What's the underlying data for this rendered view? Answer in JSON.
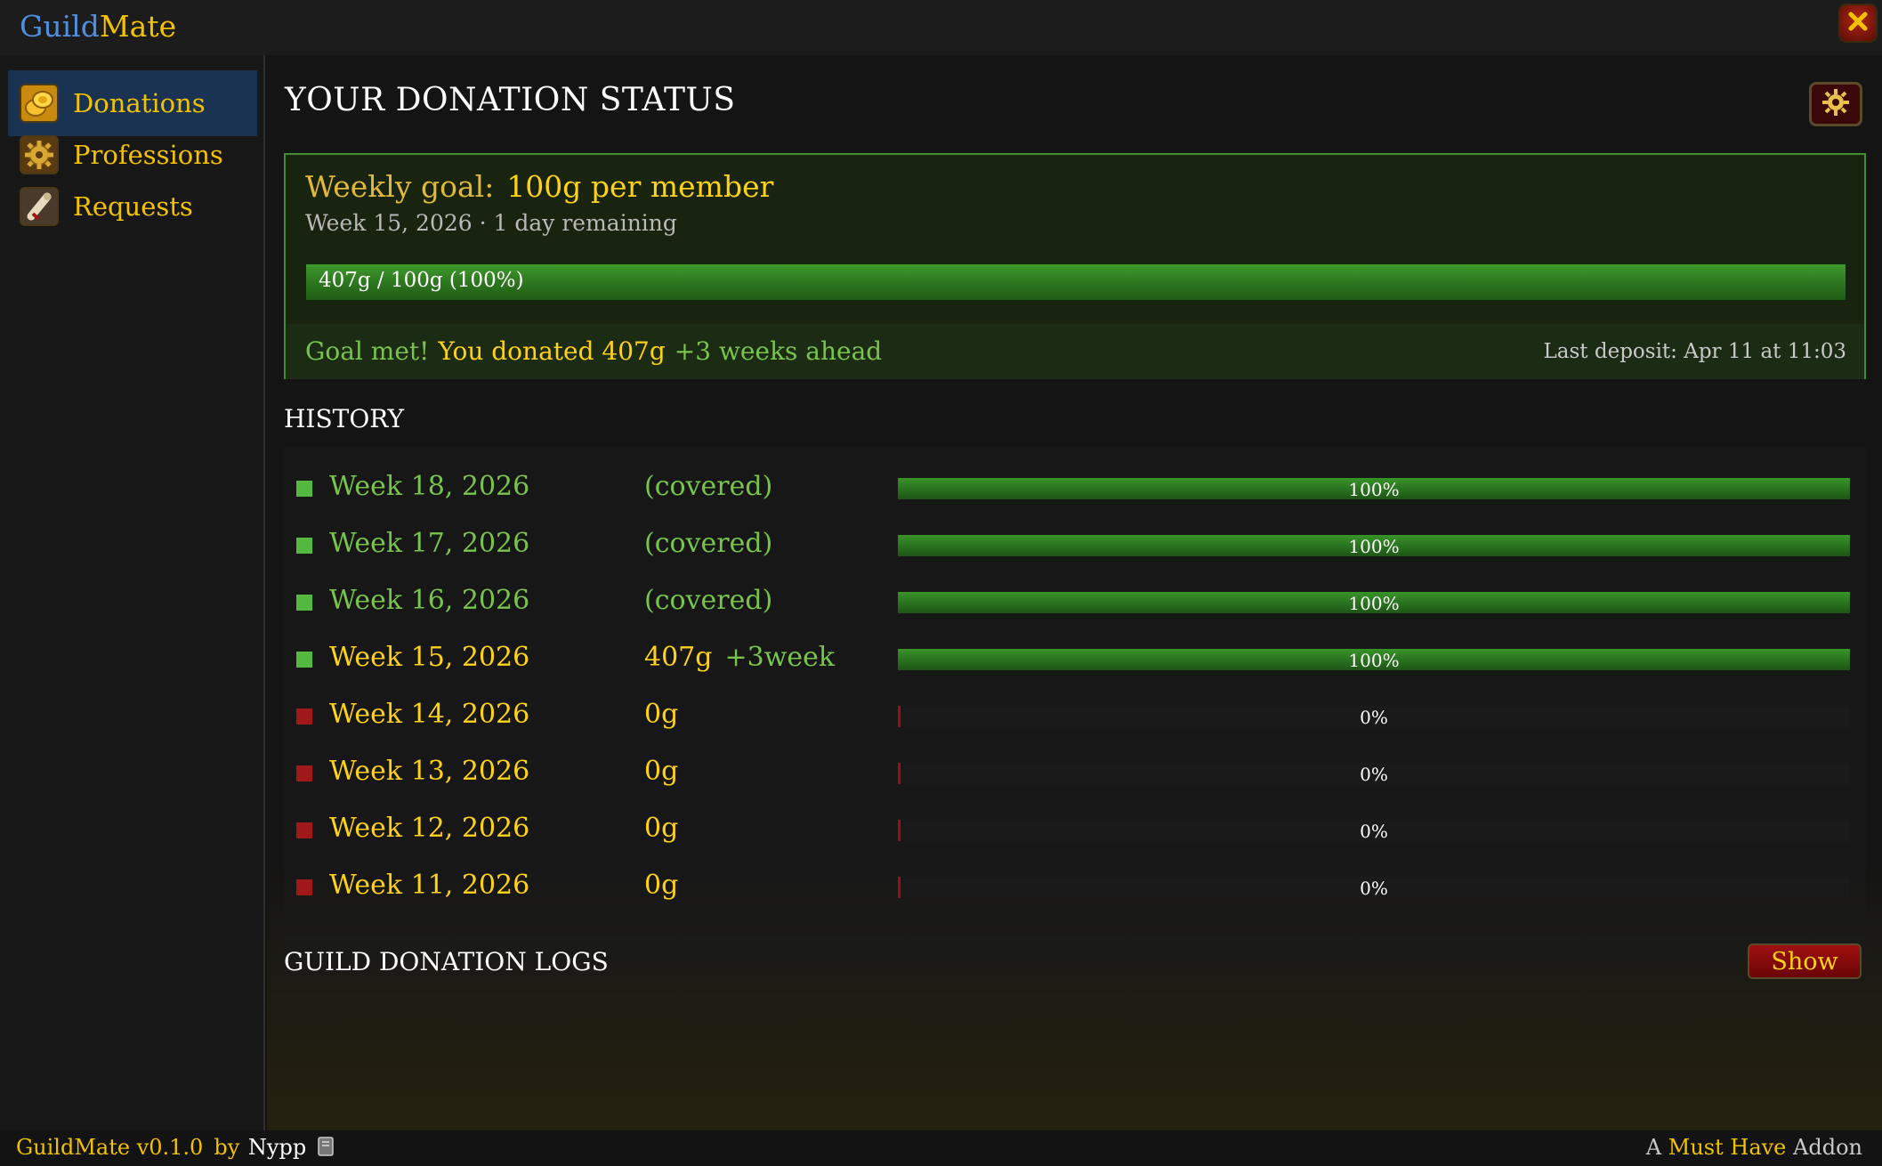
{
  "app": {
    "title_part1": "Guild",
    "title_part2": "Mate"
  },
  "sidebar": {
    "items": [
      {
        "label": "Donations",
        "icon": "coins-icon",
        "active": true
      },
      {
        "label": "Professions",
        "icon": "gear-cog-icon",
        "active": false
      },
      {
        "label": "Requests",
        "icon": "scroll-icon",
        "active": false
      }
    ]
  },
  "main": {
    "title": "YOUR DONATION STATUS",
    "goal": {
      "label": "Weekly goal:",
      "value": "100g per member",
      "subtitle": "Week 15, 2026  ·  1 day remaining",
      "progress_text": "407g / 100g  (100%)",
      "progress": 1.0,
      "met_label": "Goal met!",
      "donated": "You donated 407g",
      "ahead": "+3 weeks ahead",
      "last_deposit": "Last deposit:  Apr 11 at 11:03"
    },
    "history_title": "HISTORY",
    "history": [
      {
        "week": "Week 18, 2026",
        "amount": "(covered)",
        "extra": "",
        "percent": "100%",
        "progress": 1.0,
        "status": "covered"
      },
      {
        "week": "Week 17, 2026",
        "amount": "(covered)",
        "extra": "",
        "percent": "100%",
        "progress": 1.0,
        "status": "covered"
      },
      {
        "week": "Week 16, 2026",
        "amount": "(covered)",
        "extra": "",
        "percent": "100%",
        "progress": 1.0,
        "status": "covered"
      },
      {
        "week": "Week 15, 2026",
        "amount": "407g",
        "extra": "+3week",
        "percent": "100%",
        "progress": 1.0,
        "status": "paid"
      },
      {
        "week": "Week 14, 2026",
        "amount": "0g",
        "extra": "",
        "percent": "0%",
        "progress": 0.0,
        "status": "missed"
      },
      {
        "week": "Week 13, 2026",
        "amount": "0g",
        "extra": "",
        "percent": "0%",
        "progress": 0.0,
        "status": "missed"
      },
      {
        "week": "Week 12, 2026",
        "amount": "0g",
        "extra": "",
        "percent": "0%",
        "progress": 0.0,
        "status": "missed"
      },
      {
        "week": "Week 11, 2026",
        "amount": "0g",
        "extra": "",
        "percent": "0%",
        "progress": 0.0,
        "status": "missed"
      }
    ],
    "logs_title": "GUILD DONATION LOGS",
    "show_label": "Show"
  },
  "status_bar": {
    "version": "GuildMate v0.1.0",
    "by": "by",
    "author": "Nypp",
    "tagline_prefix": "A",
    "tagline_highlight": "Must Have",
    "tagline_suffix": "Addon"
  },
  "colors": {
    "accent_gold": "#f2c200",
    "accent_blue": "#4f8fe0",
    "covered_green": "#79c44b",
    "missed_red": "#9a1010",
    "bar_green": "#2e7720"
  },
  "icons": {
    "close": "close-icon",
    "settings": "gear-icon",
    "author_badge": "book-icon"
  }
}
